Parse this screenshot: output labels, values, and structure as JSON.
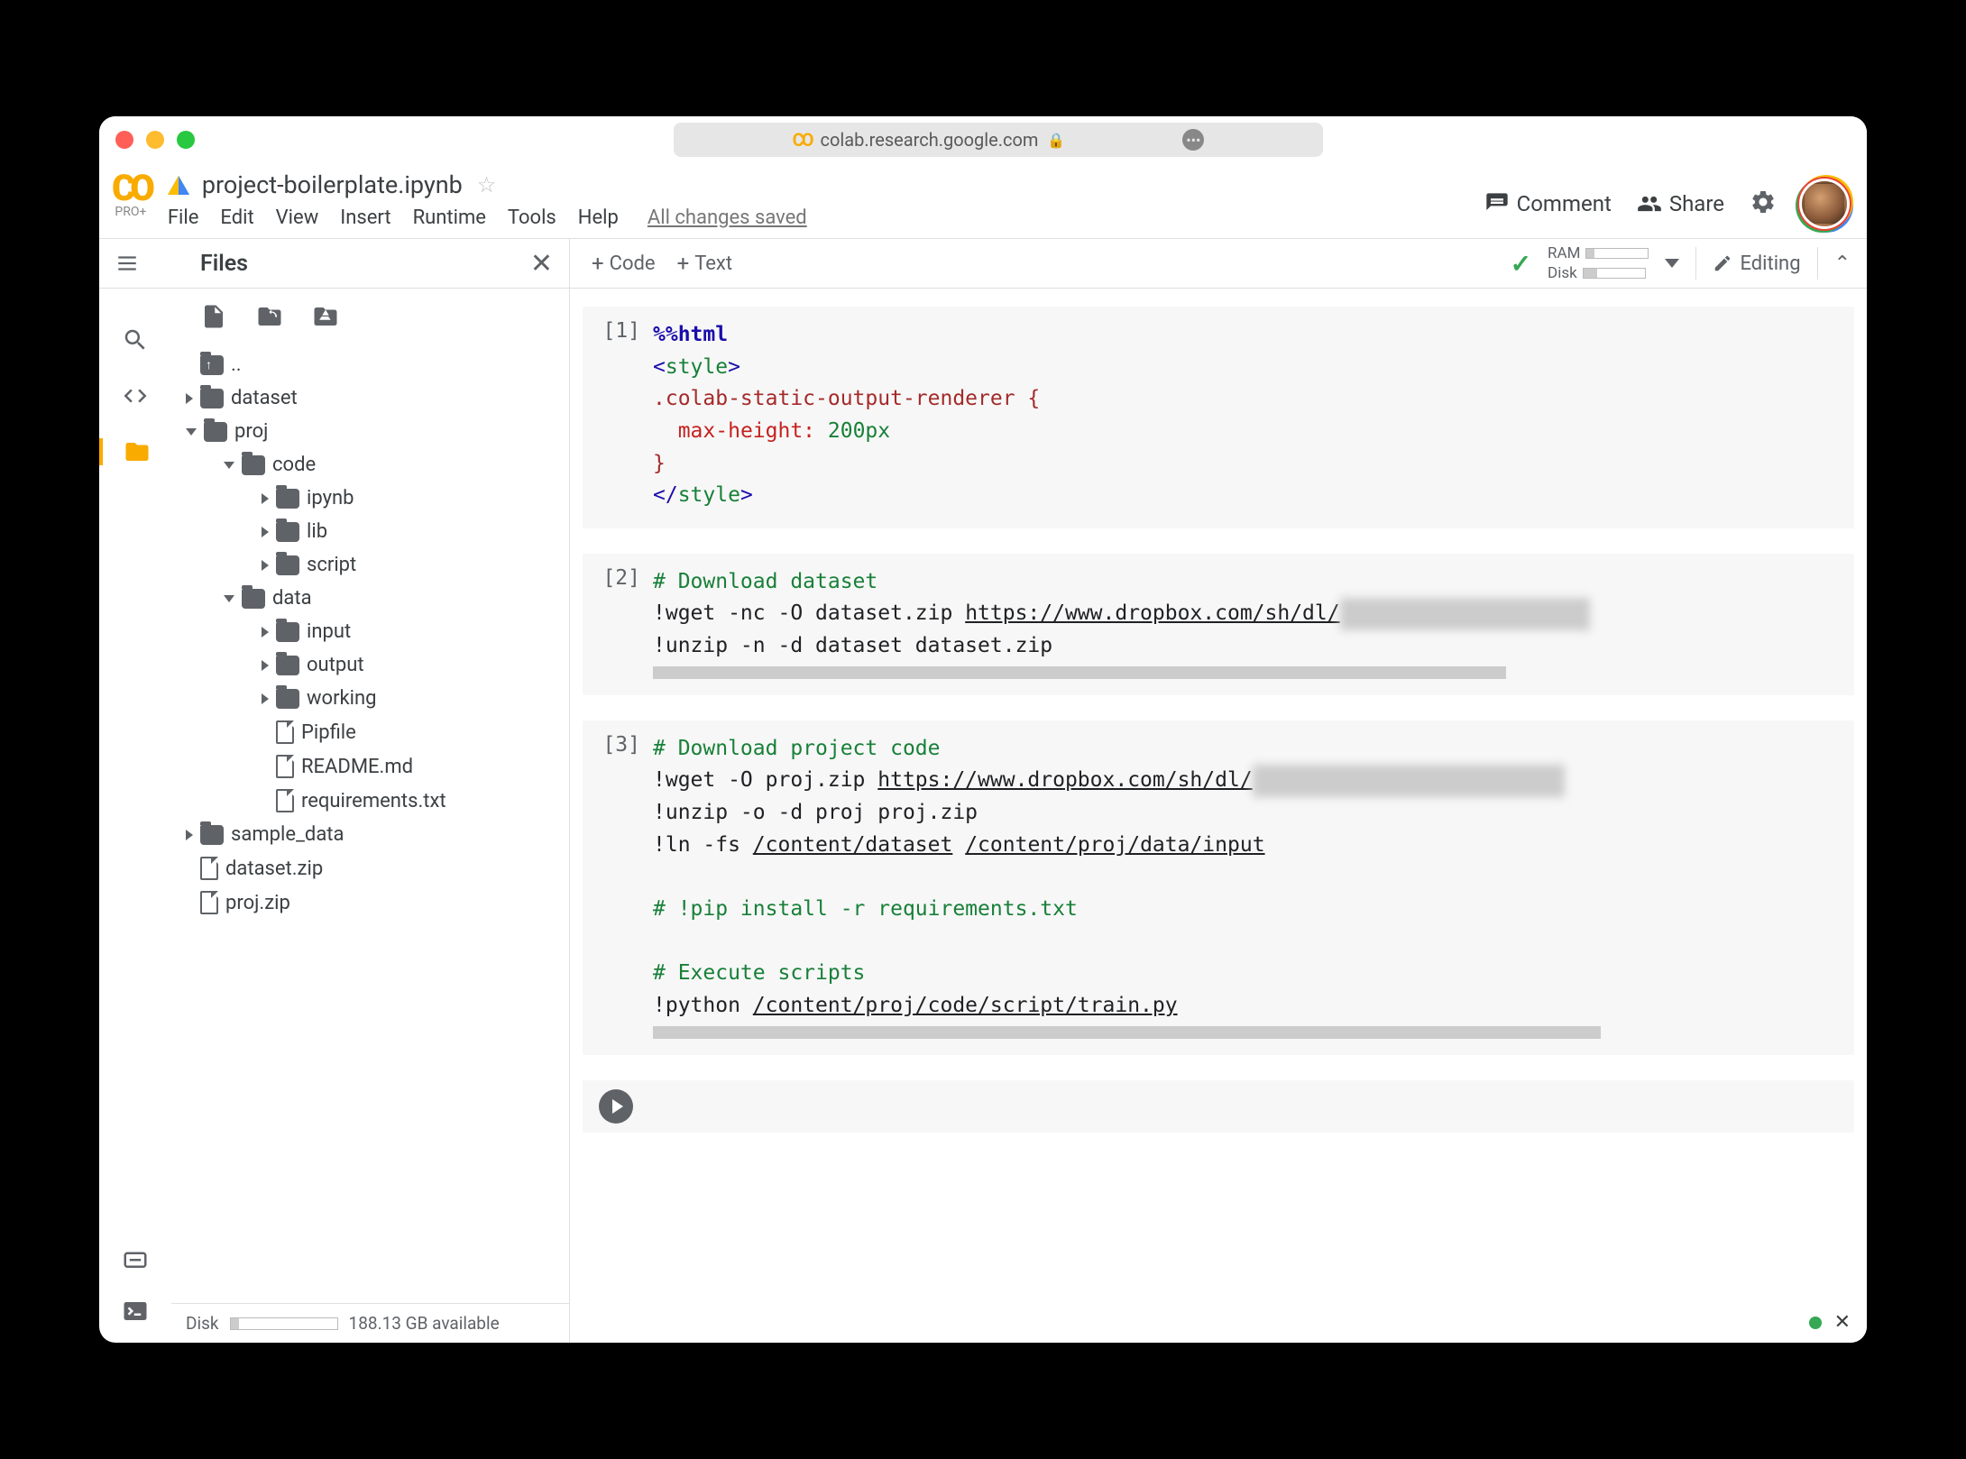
{
  "browser": {
    "url_host": "colab.research.google.com"
  },
  "header": {
    "product_sub": "PRO+",
    "notebook_title": "project-boilerplate.ipynb",
    "menus": [
      "File",
      "Edit",
      "View",
      "Insert",
      "Runtime",
      "Tools",
      "Help"
    ],
    "saved_status": "All changes saved",
    "comment_label": "Comment",
    "share_label": "Share"
  },
  "toolbar": {
    "files_title": "Files",
    "add_code": "Code",
    "add_text": "Text",
    "ram_label": "RAM",
    "disk_label": "Disk",
    "editing_label": "Editing"
  },
  "sidebar": {
    "tree": [
      {
        "type": "folder-up",
        "name": "..",
        "depth": 0,
        "arrow": "none"
      },
      {
        "type": "folder",
        "name": "dataset",
        "depth": 0,
        "arrow": "right"
      },
      {
        "type": "folder",
        "name": "proj",
        "depth": 0,
        "arrow": "down"
      },
      {
        "type": "folder",
        "name": "code",
        "depth": 1,
        "arrow": "down"
      },
      {
        "type": "folder",
        "name": "ipynb",
        "depth": 2,
        "arrow": "right"
      },
      {
        "type": "folder",
        "name": "lib",
        "depth": 2,
        "arrow": "right"
      },
      {
        "type": "folder",
        "name": "script",
        "depth": 2,
        "arrow": "right"
      },
      {
        "type": "folder",
        "name": "data",
        "depth": 1,
        "arrow": "down"
      },
      {
        "type": "folder",
        "name": "input",
        "depth": 2,
        "arrow": "right"
      },
      {
        "type": "folder",
        "name": "output",
        "depth": 2,
        "arrow": "right"
      },
      {
        "type": "folder",
        "name": "working",
        "depth": 2,
        "arrow": "right"
      },
      {
        "type": "file",
        "name": "Pipfile",
        "depth": 2,
        "arrow": "none"
      },
      {
        "type": "file",
        "name": "README.md",
        "depth": 2,
        "arrow": "none"
      },
      {
        "type": "file",
        "name": "requirements.txt",
        "depth": 2,
        "arrow": "none"
      },
      {
        "type": "folder",
        "name": "sample_data",
        "depth": 0,
        "arrow": "right"
      },
      {
        "type": "file",
        "name": "dataset.zip",
        "depth": 0,
        "arrow": "none"
      },
      {
        "type": "file",
        "name": "proj.zip",
        "depth": 0,
        "arrow": "none"
      }
    ],
    "disk_label": "Disk",
    "disk_available": "188.13 GB available"
  },
  "cells": [
    {
      "num": "[1]",
      "lines": [
        [
          {
            "t": "%%",
            "c": "c-magic"
          },
          {
            "t": "html",
            "c": "c-magic"
          }
        ],
        [
          {
            "t": "<",
            "c": "c-tag"
          },
          {
            "t": "style",
            "c": "c-tagname"
          },
          {
            "t": ">",
            "c": "c-tag"
          }
        ],
        [
          {
            "t": ".colab-static-output-renderer {",
            "c": "c-sel"
          }
        ],
        [
          {
            "t": "  ",
            "c": ""
          },
          {
            "t": "max-height:",
            "c": "c-prop"
          },
          {
            "t": " ",
            "c": ""
          },
          {
            "t": "200px",
            "c": "c-val"
          }
        ],
        [
          {
            "t": "}",
            "c": "c-sel"
          }
        ],
        [
          {
            "t": "</",
            "c": "c-tag"
          },
          {
            "t": "style",
            "c": "c-tagname"
          },
          {
            "t": ">",
            "c": "c-tag"
          }
        ]
      ],
      "scrollbar": false
    },
    {
      "num": "[2]",
      "lines": [
        [
          {
            "t": "# Download dataset",
            "c": "c-cmt"
          }
        ],
        [
          {
            "t": "!wget -nc -O dataset.zip ",
            "c": ""
          },
          {
            "t": "https://www.dropbox.com/sh/dl/",
            "c": "c-und"
          },
          {
            "t": "xxxxxxxxxxxxxxxxxxxx",
            "c": "blur"
          }
        ],
        [
          {
            "t": "!unzip -n -d dataset dataset.zip",
            "c": ""
          }
        ]
      ],
      "scrollbar": true,
      "scrollbar_width": "72%"
    },
    {
      "num": "[3]",
      "lines": [
        [
          {
            "t": "# Download project code",
            "c": "c-cmt"
          }
        ],
        [
          {
            "t": "!wget -O proj.zip ",
            "c": ""
          },
          {
            "t": "https://www.dropbox.com/sh/dl/",
            "c": "c-und"
          },
          {
            "t": "xxxxxxxxxxxxxxxxxxxxxxxxx",
            "c": "blur"
          }
        ],
        [
          {
            "t": "!unzip -o -d proj proj.zip",
            "c": ""
          }
        ],
        [
          {
            "t": "!ln -fs ",
            "c": ""
          },
          {
            "t": "/content/dataset",
            "c": "c-und"
          },
          {
            "t": " ",
            "c": ""
          },
          {
            "t": "/content/proj/data/input",
            "c": "c-und"
          }
        ],
        [
          {
            "t": "",
            "c": ""
          }
        ],
        [
          {
            "t": "# !pip install -r requirements.txt",
            "c": "c-cmt"
          }
        ],
        [
          {
            "t": "",
            "c": ""
          }
        ],
        [
          {
            "t": "# Execute scripts",
            "c": "c-cmt"
          }
        ],
        [
          {
            "t": "!python ",
            "c": ""
          },
          {
            "t": "/content/proj/code/script/train.py",
            "c": "c-und"
          }
        ]
      ],
      "scrollbar": true,
      "scrollbar_width": "80%"
    }
  ]
}
